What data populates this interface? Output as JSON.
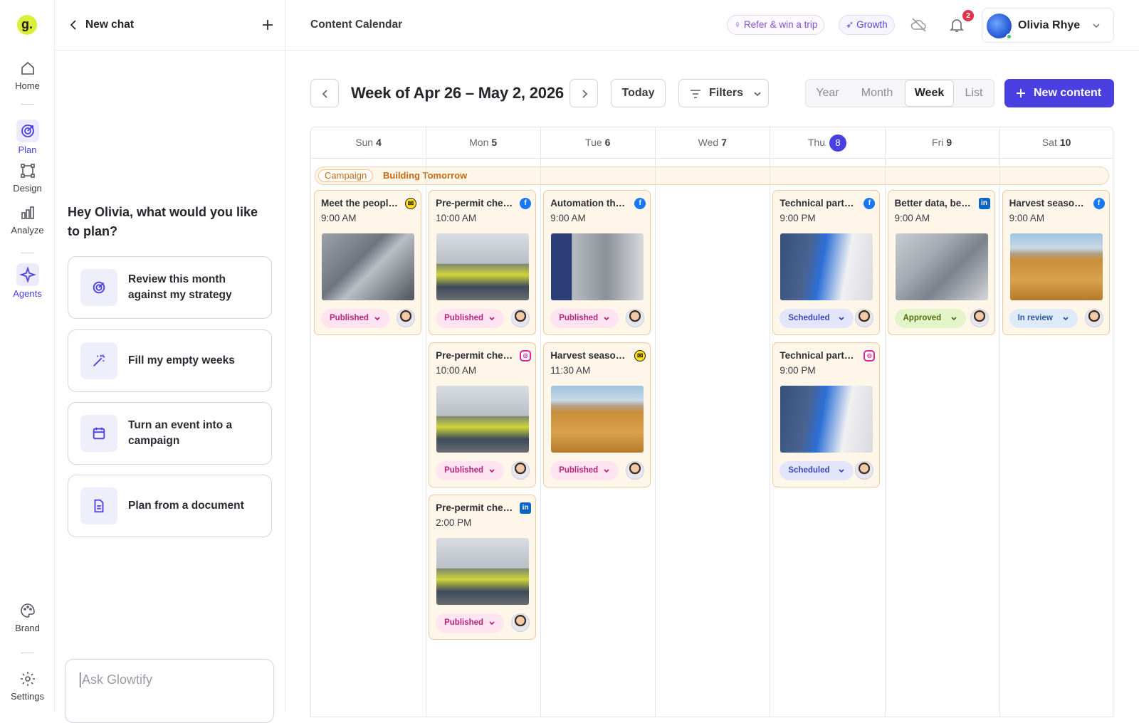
{
  "rail": {
    "logo": "g.",
    "items": [
      {
        "label": "Home",
        "icon": "home-icon"
      },
      {
        "label": "Plan",
        "icon": "target-icon",
        "active": true
      },
      {
        "label": "Design",
        "icon": "vector-icon"
      },
      {
        "label": "Analyze",
        "icon": "bar-chart-icon"
      },
      {
        "label": "Agents",
        "icon": "sparkle-icon",
        "active": true
      },
      {
        "label": "Brand",
        "icon": "palette-icon"
      },
      {
        "label": "Settings",
        "icon": "gear-icon"
      }
    ]
  },
  "chat": {
    "title": "New chat",
    "greeting": "Hey Olivia, what would you like to plan?",
    "suggestions": [
      {
        "label": "Review this month against my strategy",
        "icon": "target-icon"
      },
      {
        "label": "Fill my empty weeks",
        "icon": "magic-wand-icon"
      },
      {
        "label": "Turn an event into a campaign",
        "icon": "calendar-icon"
      },
      {
        "label": "Plan from a document",
        "icon": "document-icon"
      }
    ],
    "input_placeholder": "Ask Glowtify"
  },
  "topbar": {
    "page_title": "Content Calendar",
    "refer_label": "Refer & win a trip",
    "growth_label": "Growth",
    "notification_count": "2",
    "user_name": "Olivia Rhye"
  },
  "toolbar": {
    "week_title": "Week of Apr 26 – May 2, 2026",
    "today_label": "Today",
    "filters_label": "Filters",
    "views": [
      "Year",
      "Month",
      "Week",
      "List"
    ],
    "active_view": "Week",
    "new_content_label": "New content"
  },
  "calendar": {
    "days": [
      {
        "name": "Sun",
        "num": "4"
      },
      {
        "name": "Mon",
        "num": "5"
      },
      {
        "name": "Tue",
        "num": "6"
      },
      {
        "name": "Wed",
        "num": "7"
      },
      {
        "name": "Thu",
        "num": "8",
        "today": true
      },
      {
        "name": "Fri",
        "num": "9"
      },
      {
        "name": "Sat",
        "num": "10"
      }
    ],
    "campaign": {
      "tag": "Campaign",
      "name": "Building Tomorrow"
    },
    "posts": [
      {
        "day": 0,
        "slot": 0,
        "title": "Meet the people behind the machines",
        "time": "9:00 AM",
        "network": "mailchimp",
        "image": "machine",
        "status": "Published"
      },
      {
        "day": 1,
        "slot": 0,
        "title": "Pre-permit checklist",
        "time": "10:00 AM",
        "network": "facebook",
        "image": "silo",
        "status": "Published"
      },
      {
        "day": 1,
        "slot": 1,
        "title": "Pre-permit checklist",
        "time": "10:00 AM",
        "network": "instagram",
        "image": "silo",
        "status": "Published"
      },
      {
        "day": 1,
        "slot": 2,
        "title": "Pre-permit checklist",
        "time": "2:00 PM",
        "network": "linkedin",
        "image": "silo",
        "status": "Published"
      },
      {
        "day": 2,
        "slot": 0,
        "title": "Automation that works",
        "time": "9:00 AM",
        "network": "facebook",
        "image": "automation",
        "status": "Published"
      },
      {
        "day": 2,
        "slot": 1,
        "title": "Harvest season is here",
        "time": "11:30 AM",
        "network": "mailchimp",
        "image": "field",
        "status": "Published"
      },
      {
        "day": 4,
        "slot": 0,
        "title": "Technical partnership",
        "time": "9:00 PM",
        "network": "facebook",
        "image": "tech",
        "status": "Scheduled"
      },
      {
        "day": 4,
        "slot": 1,
        "title": "Technical partnership",
        "time": "9:00 PM",
        "network": "instagram",
        "image": "tech",
        "status": "Scheduled"
      },
      {
        "day": 5,
        "slot": 0,
        "title": "Better data, better decisions",
        "time": "9:00 AM",
        "network": "linkedin",
        "image": "processor",
        "status": "Approved"
      },
      {
        "day": 6,
        "slot": 0,
        "title": "Harvest season is here",
        "time": "9:00 AM",
        "network": "facebook",
        "image": "field",
        "status": "In review"
      }
    ]
  },
  "colors": {
    "accent": "#4a3fe0",
    "campaign_bg": "#fff6ea",
    "published": "#b5247a",
    "scheduled": "#3d46b8",
    "approved": "#4f6d12",
    "in_review": "#2c5aa0"
  }
}
